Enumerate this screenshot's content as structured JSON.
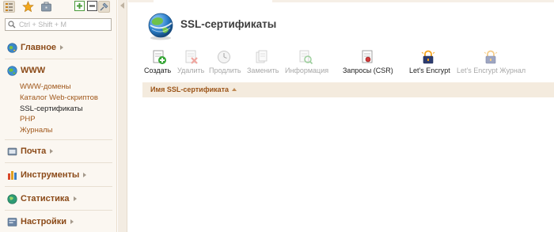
{
  "sidebar": {
    "search": {
      "placeholder": "Ctrl + Shift + M"
    },
    "sections": [
      {
        "label": "Главное"
      },
      {
        "label": "WWW",
        "items": [
          "WWW-домены",
          "Каталог Web-скриптов",
          "SSL-сертификаты",
          "PHP",
          "Журналы"
        ],
        "active": "SSL-сертификаты"
      },
      {
        "label": "Почта"
      },
      {
        "label": "Инструменты"
      },
      {
        "label": "Статистика"
      },
      {
        "label": "Настройки"
      }
    ]
  },
  "main": {
    "title": "SSL-сертификаты",
    "toolbar": [
      {
        "label": "Создать",
        "enabled": true,
        "icon": "create-icon"
      },
      {
        "label": "Удалить",
        "enabled": false,
        "icon": "delete-icon"
      },
      {
        "label": "Продлить",
        "enabled": false,
        "icon": "renew-icon"
      },
      {
        "label": "Заменить",
        "enabled": false,
        "icon": "replace-icon"
      },
      {
        "label": "Информация",
        "enabled": false,
        "icon": "info-icon"
      },
      {
        "label": "Запросы (CSR)",
        "enabled": true,
        "icon": "csr-icon"
      },
      {
        "label": "Let's Encrypt",
        "enabled": true,
        "icon": "lets-encrypt-icon"
      },
      {
        "label": "Let's Encrypt Журнал",
        "enabled": false,
        "icon": "lets-encrypt-log-icon"
      }
    ],
    "table": {
      "columns": [
        {
          "label": "Имя SSL-сертификата",
          "sort": "ascending"
        }
      ],
      "rows": []
    }
  },
  "colors": {
    "accent": "#8b4a18",
    "link": "#a0581c",
    "header_bg": "#f4ebde",
    "sidebar_bg": "#fbf7f1"
  }
}
